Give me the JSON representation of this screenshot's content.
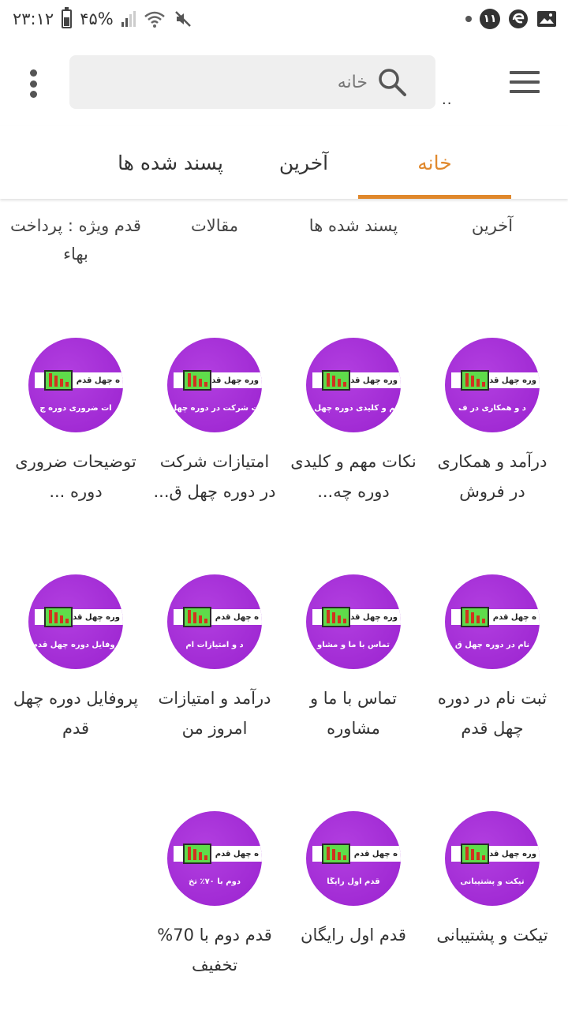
{
  "status_bar": {
    "time": "۲۳:۱۲",
    "battery_percent": "۴۵%",
    "notification_count": "۱۱",
    "icons": [
      "battery-icon",
      "signal-icon",
      "wifi-icon",
      "mute-icon",
      "image-notification-icon",
      "edge-browser-icon"
    ]
  },
  "appbar": {
    "search_placeholder": "خانه",
    "extra": ".."
  },
  "tabs": [
    {
      "label": "خانه",
      "active": true
    },
    {
      "label": "آخرین",
      "active": false
    },
    {
      "label": "پسند شده ها",
      "active": false
    }
  ],
  "links": [
    {
      "label": "آخرین"
    },
    {
      "label": "پسند شده ها"
    },
    {
      "label": "مقالات"
    },
    {
      "label": "قدم ویژه : پرداخت بهاء"
    }
  ],
  "items": [
    {
      "label": "درآمد و همکاری در فروش",
      "thumb_header": "وره چهل قدم",
      "thumb_sub": "د و همکاری در ف"
    },
    {
      "label": "نکات مهم و کلیدی دوره چه...",
      "thumb_header": "وره چهل قدم",
      "thumb_sub": "هم و کلیدی دوره چهل ق"
    },
    {
      "label": "امتیازات شرکت در دوره چهل ق...",
      "thumb_header": "وره چهل قدم",
      "thumb_sub": "ت شرکت در دوره چهل"
    },
    {
      "label": "توضیحات ضروری دوره ...",
      "thumb_header": "ه چهل قدم",
      "thumb_sub": "ات ضروری دوره چ"
    },
    {
      "label": "ثبت نام در دوره چهل قدم",
      "thumb_header": "ه چهل قدم",
      "thumb_sub": "نام در دوره چهل ق"
    },
    {
      "label": "تماس با ما و مشاوره",
      "thumb_header": "وره چهل قدم",
      "thumb_sub": "تماس با ما و مشاو"
    },
    {
      "label": "درآمد و امتیازات امروز من",
      "thumb_header": "ه چهل قدم",
      "thumb_sub": "د و امتیازات ام"
    },
    {
      "label": "پروفایل دوره چهل قدم",
      "thumb_header": "وره چهل قدم",
      "thumb_sub": "روفایل دوره چهل قدم"
    },
    {
      "label": "تیکت و پشتیبانی",
      "thumb_header": "وره چهل قدم",
      "thumb_sub": "تیکت و پشتیبانی"
    },
    {
      "label": "قدم اول رایگان",
      "thumb_header": "ه چهل قدم",
      "thumb_sub": "قدم اول رایگا"
    },
    {
      "label": "قدم دوم با 70% تخفیف",
      "thumb_header": "ه چهل قدم",
      "thumb_sub": "دوم با ۷۰٪ تخ"
    }
  ],
  "colors": {
    "accent": "#e0882c",
    "thumb_purple": "#a52fd8",
    "chip_green": "#5fdc4a",
    "chart_red": "#d1331e"
  }
}
